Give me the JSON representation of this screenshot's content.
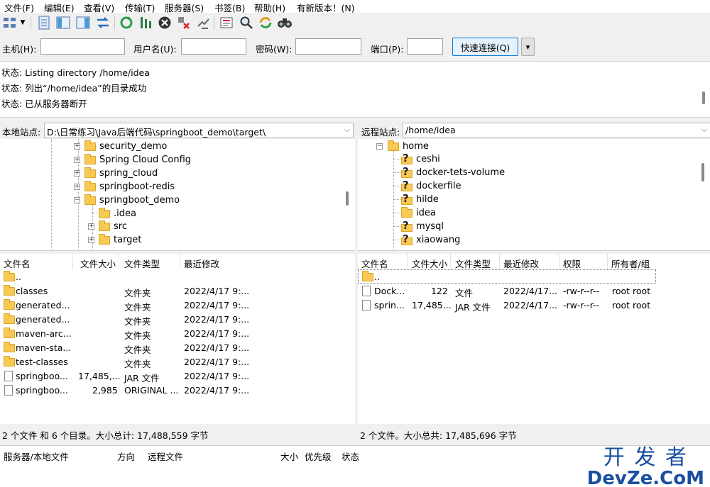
{
  "menu": [
    "文件(F)",
    "编辑(E)",
    "查看(V)",
    "传输(T)",
    "服务器(S)",
    "书签(B)",
    "帮助(H)",
    "有新版本！(N)"
  ],
  "toolbar_icons": [
    "site-manager-icon",
    "dropdown-arrow-icon",
    "toggle-log-icon",
    "toggle-local-tree-icon",
    "toggle-remote-tree-icon",
    "toggle-queue-icon",
    "refresh-icon",
    "process-queue-icon",
    "cancel-icon",
    "disconnect-icon",
    "reconnect-icon",
    "filter-icon",
    "compare-icon",
    "sync-browse-icon",
    "find-icon"
  ],
  "quickconnect": {
    "host_label": "主机(H):",
    "user_label": "用户名(U):",
    "pass_label": "密码(W):",
    "port_label": "端口(P):",
    "button": "快速连接(Q)",
    "dropdown": "▾"
  },
  "log": [
    "状态:  Listing directory /home/idea",
    "状态:  列出“/home/idea”的目录成功",
    "状态:  已从服务器断开"
  ],
  "local": {
    "label": "本地站点:",
    "path": "D:\\日常练习\\Java后端代码\\springboot_demo\\target\\",
    "tree": [
      "security_demo",
      "Spring Cloud Config",
      "spring_cloud",
      "springboot-redis",
      "springboot_demo",
      ".idea",
      "src",
      "target"
    ],
    "columns": [
      "文件名",
      "文件大小",
      "文件类型",
      "最近修改"
    ],
    "files": [
      {
        "name": "..",
        "size": "",
        "type": "",
        "modified": ""
      },
      {
        "name": "classes",
        "size": "",
        "type": "文件夹",
        "modified": "2022/4/17 9:..."
      },
      {
        "name": "generated...",
        "size": "",
        "type": "文件夹",
        "modified": "2022/4/17 9:..."
      },
      {
        "name": "generated...",
        "size": "",
        "type": "文件夹",
        "modified": "2022/4/17 9:..."
      },
      {
        "name": "maven-arc...",
        "size": "",
        "type": "文件夹",
        "modified": "2022/4/17 9:..."
      },
      {
        "name": "maven-sta...",
        "size": "",
        "type": "文件夹",
        "modified": "2022/4/17 9:..."
      },
      {
        "name": "test-classes",
        "size": "",
        "type": "文件夹",
        "modified": "2022/4/17 9:..."
      },
      {
        "name": "springboo...",
        "size": "17,485,...",
        "type": "JAR 文件",
        "modified": "2022/4/17 9:..."
      },
      {
        "name": "springboo...",
        "size": "2,985",
        "type": "ORIGINAL ...",
        "modified": "2022/4/17 9:..."
      }
    ],
    "status": "2 个文件 和 6 个目录。大小总计: 17,488,559 字节"
  },
  "remote": {
    "label": "远程站点:",
    "path": "/home/idea",
    "tree": [
      "home",
      "ceshi",
      "docker-tets-volume",
      "dockerfile",
      "hilde",
      "idea",
      "mysql",
      "xiaowang"
    ],
    "columns": [
      "文件名",
      "文件大小",
      "文件类型",
      "最近修改",
      "权限",
      "所有者/组"
    ],
    "files": [
      {
        "name": "..",
        "size": "",
        "type": "",
        "modified": "",
        "perm": "",
        "owner": ""
      },
      {
        "name": "Dock...",
        "size": "122",
        "type": "文件",
        "modified": "2022/4/17...",
        "perm": "-rw-r--r--",
        "owner": "root root"
      },
      {
        "name": "sprin...",
        "size": "17,485...",
        "type": "JAR 文件",
        "modified": "2022/4/17...",
        "perm": "-rw-r--r--",
        "owner": "root root"
      }
    ],
    "status": "2 个文件。大小总共: 17,485,696 字节"
  },
  "queue": {
    "columns": [
      "服务器/本地文件",
      "方向",
      "远程文件",
      "大小",
      "优先级",
      "状态"
    ]
  },
  "watermark": {
    "line1": "开 发 者",
    "line2": "DevZe.CoM"
  }
}
